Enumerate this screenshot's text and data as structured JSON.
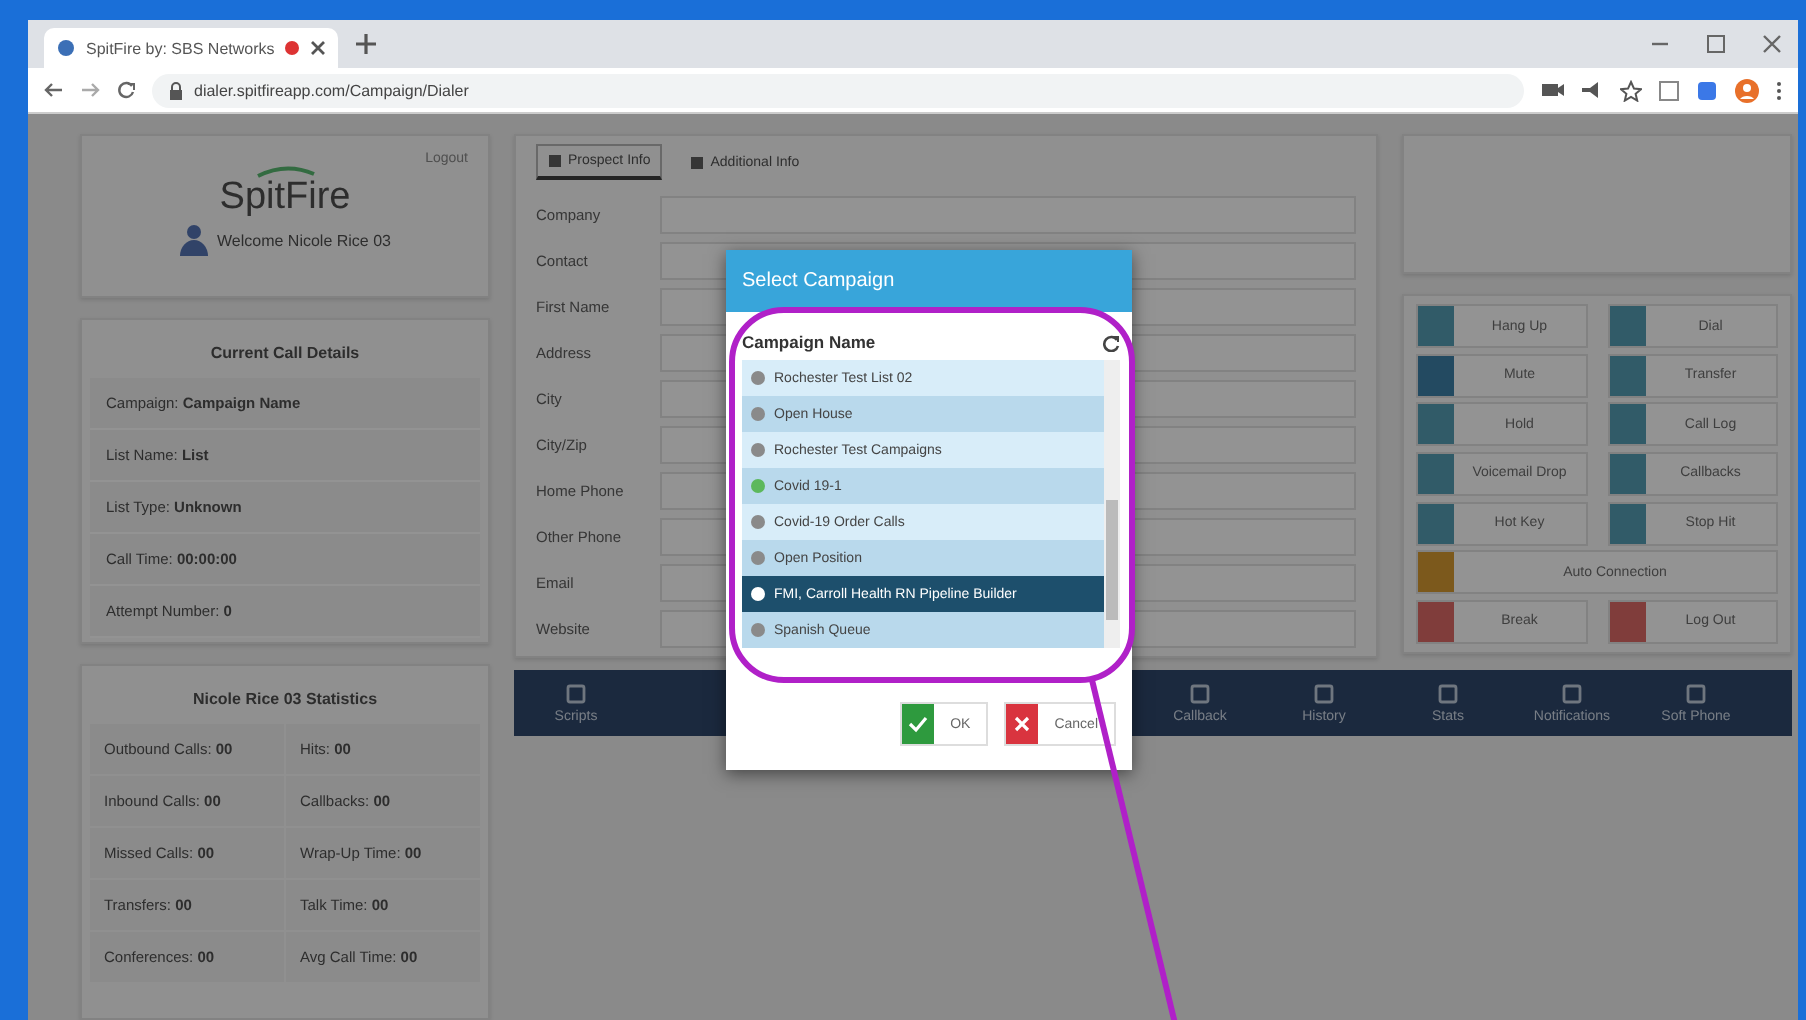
{
  "browser": {
    "tab_title": "SpitFire by: SBS Networks",
    "url": "dialer.spitfireapp.com/Campaign/Dialer"
  },
  "profile": {
    "logout": "Logout",
    "logo": "SpitFire",
    "welcome": "Welcome Nicole Rice 03"
  },
  "call_details": {
    "title": "Current Call Details",
    "rows": [
      {
        "label": "Campaign:",
        "value": "Campaign Name"
      },
      {
        "label": "List Name:",
        "value": "List"
      },
      {
        "label": "List Type:",
        "value": "Unknown"
      },
      {
        "label": "Call Time:",
        "value": "00:00:00"
      },
      {
        "label": "Attempt Number:",
        "value": "0"
      }
    ]
  },
  "statistics": {
    "title": "Nicole Rice 03 Statistics",
    "cells": [
      {
        "label": "Outbound Calls:",
        "value": "00"
      },
      {
        "label": "Hits:",
        "value": "00"
      },
      {
        "label": "Inbound Calls:",
        "value": "00"
      },
      {
        "label": "Callbacks:",
        "value": "00"
      },
      {
        "label": "Missed Calls:",
        "value": "00"
      },
      {
        "label": "Wrap-Up Time:",
        "value": "00"
      },
      {
        "label": "Transfers:",
        "value": "00"
      },
      {
        "label": "Talk Time:",
        "value": "00"
      },
      {
        "label": "Conferences:",
        "value": "00"
      },
      {
        "label": "Avg Call Time:",
        "value": "00"
      }
    ]
  },
  "form_tabs": [
    {
      "label": "Prospect Info",
      "selected": true
    },
    {
      "label": "Additional Info",
      "selected": false
    }
  ],
  "fields": [
    {
      "label": "Company"
    },
    {
      "label": "Contact"
    },
    {
      "label": "First Name"
    },
    {
      "label": "Address"
    },
    {
      "label": "City"
    },
    {
      "label": "City/Zip"
    },
    {
      "label": "Home Phone"
    },
    {
      "label": "Other Phone"
    },
    {
      "label": "Email"
    },
    {
      "label": "Website"
    }
  ],
  "controls": [
    {
      "label": "Hang Up",
      "kind": "normal"
    },
    {
      "label": "Dial",
      "kind": "normal"
    },
    {
      "label": "Mute",
      "kind": "active"
    },
    {
      "label": "Transfer",
      "kind": "normal"
    },
    {
      "label": "Hold",
      "kind": "normal"
    },
    {
      "label": "Call Log",
      "kind": "normal"
    },
    {
      "label": "Voicemail Drop",
      "kind": "normal"
    },
    {
      "label": "Callbacks",
      "kind": "normal"
    },
    {
      "label": "Hot Key",
      "kind": "normal"
    },
    {
      "label": "Stop Hit",
      "kind": "normal"
    }
  ],
  "auto_connection": {
    "label": "Auto Connection"
  },
  "exit_controls": [
    {
      "label": "Break"
    },
    {
      "label": "Log Out"
    }
  ],
  "toolbar": [
    {
      "label": "Scripts"
    },
    {
      "label": "Callback"
    },
    {
      "label": "History"
    },
    {
      "label": "Stats"
    },
    {
      "label": "Notifications"
    },
    {
      "label": "Soft Phone"
    }
  ],
  "dialog": {
    "title": "Select Campaign",
    "column": "Campaign Name",
    "items": [
      {
        "label": "Rochester Test List 02",
        "color": "#8a8a8a",
        "selected": false
      },
      {
        "label": "Open House",
        "color": "#8a8a8a",
        "selected": false
      },
      {
        "label": "Rochester Test Campaigns",
        "color": "#8a8a8a",
        "selected": false
      },
      {
        "label": "Covid 19-1",
        "color": "#5cb85c",
        "selected": false
      },
      {
        "label": "Covid-19 Order Calls",
        "color": "#8a8a8a",
        "selected": false
      },
      {
        "label": "Open Position",
        "color": "#8a8a8a",
        "selected": false
      },
      {
        "label": "FMI, Carroll Health RN Pipeline Builder",
        "color": "#ffffff",
        "selected": true
      },
      {
        "label": "Spanish Queue",
        "color": "#8a8a8a",
        "selected": false
      }
    ],
    "ok": "OK",
    "cancel": "Cancel"
  }
}
